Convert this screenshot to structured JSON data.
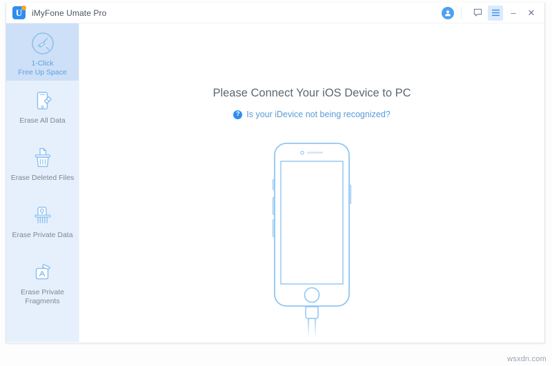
{
  "window": {
    "app_title": "iMyFone Umate Pro",
    "logo_letter": "U"
  },
  "titlebar": {
    "avatar_icon": "user-avatar-icon",
    "feedback_icon": "feedback-chat-icon",
    "menu_icon": "hamburger-menu-icon",
    "minimize_label": "–",
    "close_label": "✕"
  },
  "sidebar": {
    "items": [
      {
        "label_line1": "1-Click",
        "label_line2": "Free Up Space",
        "icon": "broom-circle-icon",
        "selected": true
      },
      {
        "label_line1": "Erase All Data",
        "label_line2": "",
        "icon": "phone-eraser-icon",
        "selected": false
      },
      {
        "label_line1": "Erase Deleted Files",
        "label_line2": "",
        "icon": "trash-document-icon",
        "selected": false
      },
      {
        "label_line1": "Erase Private Data",
        "label_line2": "",
        "icon": "shredder-lock-icon",
        "selected": false
      },
      {
        "label_line1": "Erase Private",
        "label_line2": "Fragments",
        "icon": "app-bag-icon",
        "selected": false
      }
    ]
  },
  "main": {
    "headline": "Please Connect Your iOS Device to PC",
    "hint_icon": "question-mark-icon",
    "hint_question_glyph": "?",
    "hint_link": "Is your iDevice not being recognized?",
    "illustration": "iphone-with-lightning-cable-illustration"
  },
  "watermark": {
    "text": "wsxdn.com"
  },
  "colors": {
    "accent_blue": "#2f8df0",
    "logo_orange": "#f5a623",
    "sidebar_bg": "#e6f0fc",
    "sidebar_selected_bg": "#cde0f7",
    "icon_blue": "#7cb5ec",
    "phone_stroke": "#8ec5f5",
    "headline_gray": "#5c6671",
    "label_gray": "#7b8794"
  }
}
